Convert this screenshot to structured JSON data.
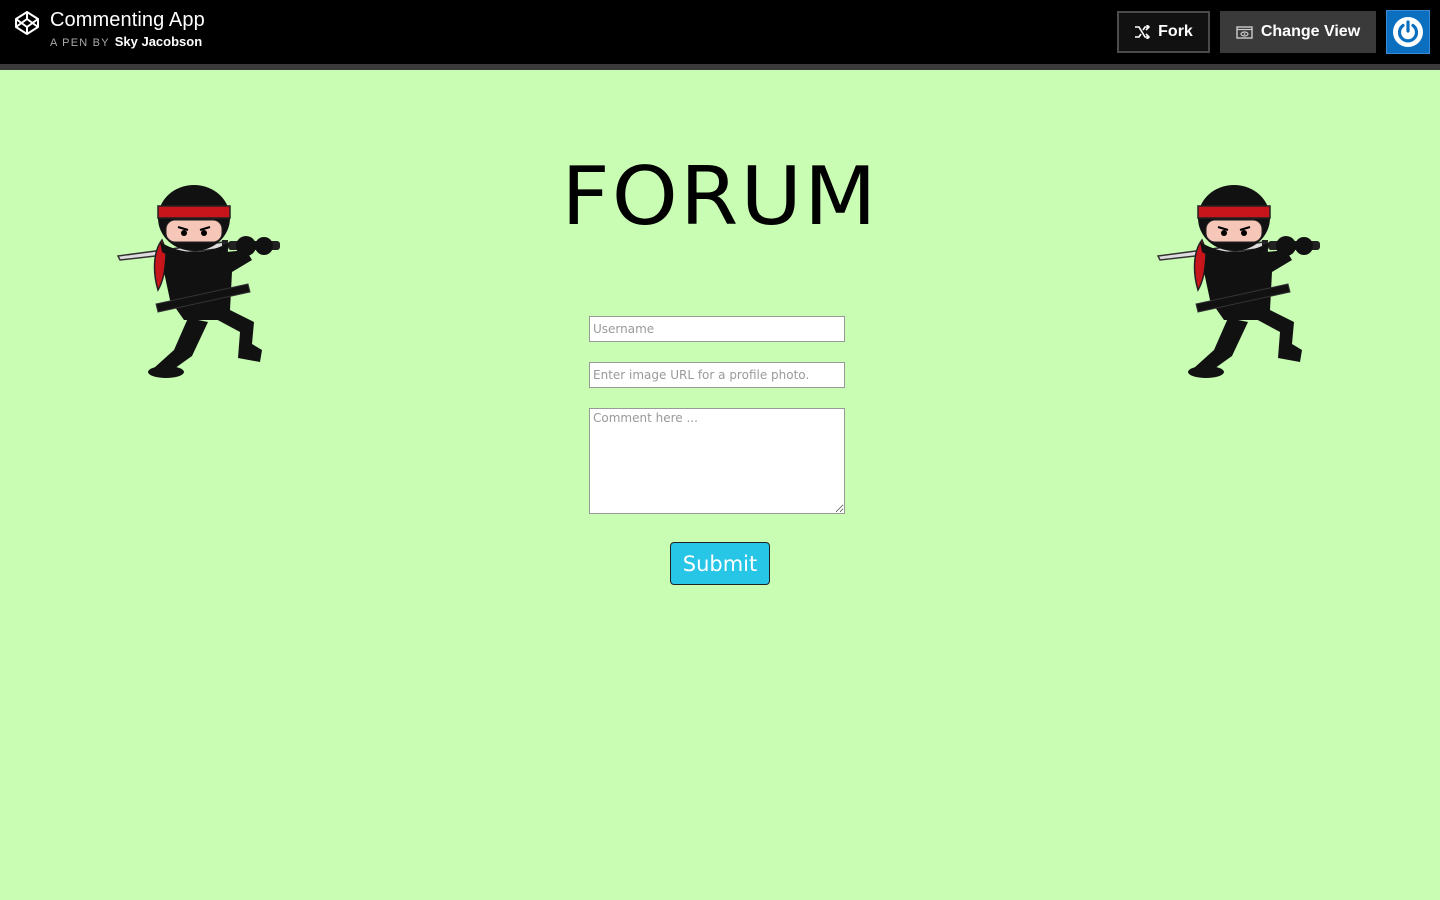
{
  "header": {
    "pen_title": "Commenting App",
    "pen_by_label": "A PEN BY",
    "author": "Sky Jacobson",
    "fork_label": "Fork",
    "change_view_label": "Change View"
  },
  "main": {
    "title": "FORUM",
    "username_placeholder": "Username",
    "image_url_placeholder": "Enter image URL for a profile photo.",
    "comment_placeholder": "Comment here ...",
    "submit_label": "Submit"
  },
  "icons": {
    "logo": "codepen-logo-icon",
    "fork": "fork-icon",
    "change_view": "eye-icon",
    "user": "power-icon"
  },
  "colors": {
    "background": "#c9fdb4",
    "topbar": "#000000",
    "submit": "#27c5e6",
    "avatar": "#0a6fbf"
  }
}
